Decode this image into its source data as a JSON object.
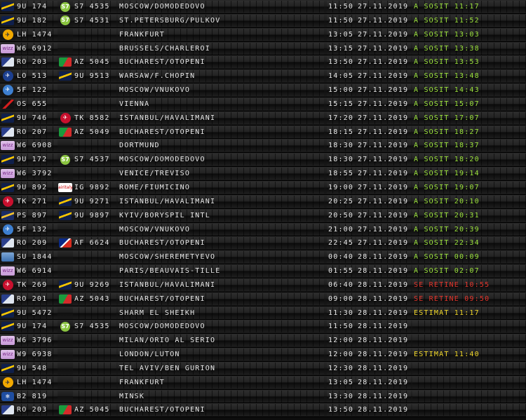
{
  "flights": [
    {
      "logo": "wizz-9u-icon",
      "logo_class": "lg-9u",
      "flight": "9U 174",
      "codeshare_logo": "s7-icon",
      "codeshare_class": "lg-s7",
      "codeshare": "S7 4535",
      "destination": "MOSCOW/DOMODEDOVO",
      "time": "11:50",
      "date": "27.11.2019",
      "status": "A SOSIT 11:17",
      "status_color": "green"
    },
    {
      "logo": "air-moldova-icon",
      "logo_class": "lg-9u",
      "flight": "9U 182",
      "codeshare_logo": "s7-icon",
      "codeshare_class": "lg-s7",
      "codeshare": "S7 4531",
      "destination": "ST.PETERSBURG/PULKOV",
      "time": "11:50",
      "date": "27.11.2019",
      "status": "A SOSIT 11:52",
      "status_color": "green"
    },
    {
      "logo": "lufthansa-icon",
      "logo_class": "lg-lh",
      "flight": "LH 1474",
      "codeshare_logo": "",
      "codeshare_class": "",
      "codeshare": "",
      "destination": "FRANKFURT",
      "time": "13:05",
      "date": "27.11.2019",
      "status": "A SOSIT 13:03",
      "status_color": "green"
    },
    {
      "logo": "wizz-air-icon",
      "logo_class": "lg-w6",
      "flight": "W6 6912",
      "codeshare_logo": "",
      "codeshare_class": "",
      "codeshare": "",
      "destination": "BRUSSELS/CHARLEROI",
      "time": "13:15",
      "date": "27.11.2019",
      "status": "A SOSIT 13:38",
      "status_color": "green"
    },
    {
      "logo": "tarom-icon",
      "logo_class": "lg-ro",
      "flight": "RO 203",
      "codeshare_logo": "alitalia-icon",
      "codeshare_class": "lg-az",
      "codeshare": "AZ 5045",
      "destination": "BUCHAREST/OTOPENI",
      "time": "13:50",
      "date": "27.11.2019",
      "status": "A SOSIT 13:53",
      "status_color": "green"
    },
    {
      "logo": "lot-icon",
      "logo_class": "lg-lo",
      "flight": "LO 513",
      "codeshare_logo": "air-moldova-icon",
      "codeshare_class": "lg-9u",
      "codeshare": "9U 9513",
      "destination": "WARSAW/F.CHOPIN",
      "time": "14:05",
      "date": "27.11.2019",
      "status": "A SOSIT 13:48",
      "status_color": "green"
    },
    {
      "logo": "utair-icon",
      "logo_class": "lg-5f",
      "flight": "5F 122",
      "codeshare_logo": "",
      "codeshare_class": "",
      "codeshare": "",
      "destination": "MOSCOW/VNUKOVO",
      "time": "15:00",
      "date": "27.11.2019",
      "status": "A SOSIT 14:43",
      "status_color": "green"
    },
    {
      "logo": "austrian-icon",
      "logo_class": "lg-os",
      "flight": "OS 655",
      "codeshare_logo": "",
      "codeshare_class": "",
      "codeshare": "",
      "destination": "VIENNA",
      "time": "15:15",
      "date": "27.11.2019",
      "status": "A SOSIT 15:07",
      "status_color": "green"
    },
    {
      "logo": "air-moldova-icon",
      "logo_class": "lg-9u",
      "flight": "9U 746",
      "codeshare_logo": "turkish-airlines-icon",
      "codeshare_class": "lg-tk",
      "codeshare": "TK 8582",
      "destination": "ISTANBUL/HAVALIMANI",
      "time": "17:20",
      "date": "27.11.2019",
      "status": "A SOSIT 17:07",
      "status_color": "green"
    },
    {
      "logo": "tarom-icon",
      "logo_class": "lg-ro",
      "flight": "RO 207",
      "codeshare_logo": "alitalia-icon",
      "codeshare_class": "lg-az",
      "codeshare": "AZ 5049",
      "destination": "BUCHAREST/OTOPENI",
      "time": "18:15",
      "date": "27.11.2019",
      "status": "A SOSIT 18:27",
      "status_color": "green"
    },
    {
      "logo": "wizz-air-icon",
      "logo_class": "lg-w6",
      "flight": "W6 6908",
      "codeshare_logo": "",
      "codeshare_class": "",
      "codeshare": "",
      "destination": "DORTMUND",
      "time": "18:30",
      "date": "27.11.2019",
      "status": "A SOSIT 18:37",
      "status_color": "green"
    },
    {
      "logo": "air-moldova-icon",
      "logo_class": "lg-9u",
      "flight": "9U 172",
      "codeshare_logo": "s7-icon",
      "codeshare_class": "lg-s7",
      "codeshare": "S7 4537",
      "destination": "MOSCOW/DOMODEDOVO",
      "time": "18:30",
      "date": "27.11.2019",
      "status": "A SOSIT 18:20",
      "status_color": "green"
    },
    {
      "logo": "wizz-air-icon",
      "logo_class": "lg-w6",
      "flight": "W6 3792",
      "codeshare_logo": "",
      "codeshare_class": "",
      "codeshare": "",
      "destination": "VENICE/TREVISO",
      "time": "18:55",
      "date": "27.11.2019",
      "status": "A SOSIT 19:14",
      "status_color": "green"
    },
    {
      "logo": "air-moldova-icon",
      "logo_class": "lg-9u",
      "flight": "9U 892",
      "codeshare_logo": "airitaly-icon",
      "codeshare_class": "lg-ig",
      "codeshare": "IG 9892",
      "destination": "ROME/FIUMICINO",
      "time": "19:00",
      "date": "27.11.2019",
      "status": "A SOSIT 19:07",
      "status_color": "green"
    },
    {
      "logo": "turkish-airlines-icon",
      "logo_class": "lg-tk",
      "flight": "TK 271",
      "codeshare_logo": "air-moldova-icon",
      "codeshare_class": "lg-9u",
      "codeshare": "9U 9271",
      "destination": "ISTANBUL/HAVALIMANI",
      "time": "20:25",
      "date": "27.11.2019",
      "status": "A SOSIT 20:10",
      "status_color": "green"
    },
    {
      "logo": "ukraine-intl-icon",
      "logo_class": "lg-ps",
      "flight": "PS 897",
      "codeshare_logo": "air-moldova-icon",
      "codeshare_class": "lg-9u",
      "codeshare": "9U 9897",
      "destination": "KYIV/BORYSPIL INTL",
      "time": "20:50",
      "date": "27.11.2019",
      "status": "A SOSIT 20:31",
      "status_color": "green"
    },
    {
      "logo": "utair-icon",
      "logo_class": "lg-5f",
      "flight": "5F 132",
      "codeshare_logo": "",
      "codeshare_class": "",
      "codeshare": "",
      "destination": "MOSCOW/VNUKOVO",
      "time": "21:00",
      "date": "27.11.2019",
      "status": "A SOSIT 20:39",
      "status_color": "green"
    },
    {
      "logo": "tarom-icon",
      "logo_class": "lg-ro",
      "flight": "RO 209",
      "codeshare_logo": "air-france-icon",
      "codeshare_class": "lg-af",
      "codeshare": "AF 6624",
      "destination": "BUCHAREST/OTOPENI",
      "time": "22:45",
      "date": "27.11.2019",
      "status": "A SOSIT 22:34",
      "status_color": "green"
    },
    {
      "logo": "aeroflot-icon",
      "logo_class": "lg-su",
      "flight": "SU 1844",
      "codeshare_logo": "",
      "codeshare_class": "",
      "codeshare": "",
      "destination": "MOSCOW/SHEREMETYEVO",
      "time": "00:40",
      "date": "28.11.2019",
      "status": "A SOSIT 00:09",
      "status_color": "green"
    },
    {
      "logo": "wizz-air-icon",
      "logo_class": "lg-w6",
      "flight": "W6 6914",
      "codeshare_logo": "",
      "codeshare_class": "",
      "codeshare": "",
      "destination": "PARIS/BEAUVAIS-TILLE",
      "time": "01:55",
      "date": "28.11.2019",
      "status": "A SOSIT 02:07",
      "status_color": "green"
    },
    {
      "logo": "turkish-airlines-icon",
      "logo_class": "lg-tk",
      "flight": "TK 269",
      "codeshare_logo": "air-moldova-icon",
      "codeshare_class": "lg-9u",
      "codeshare": "9U 9269",
      "destination": "ISTANBUL/HAVALIMANI",
      "time": "06:40",
      "date": "28.11.2019",
      "status": "SE RETINE 10:55",
      "status_color": "red"
    },
    {
      "logo": "tarom-icon",
      "logo_class": "lg-ro",
      "flight": "RO 201",
      "codeshare_logo": "alitalia-icon",
      "codeshare_class": "lg-az",
      "codeshare": "AZ 5043",
      "destination": "BUCHAREST/OTOPENI",
      "time": "09:00",
      "date": "28.11.2019",
      "status": "SE RETINE 09:50",
      "status_color": "red"
    },
    {
      "logo": "air-moldova-icon",
      "logo_class": "lg-9u",
      "flight": "9U 5472",
      "codeshare_logo": "",
      "codeshare_class": "",
      "codeshare": "",
      "destination": "SHARM EL SHEIKH",
      "time": "11:30",
      "date": "28.11.2019",
      "status": "ESTIMAT 11:17",
      "status_color": "yellow"
    },
    {
      "logo": "air-moldova-icon",
      "logo_class": "lg-9u",
      "flight": "9U 174",
      "codeshare_logo": "s7-icon",
      "codeshare_class": "lg-s7",
      "codeshare": "S7 4535",
      "destination": "MOSCOW/DOMODEDOVO",
      "time": "11:50",
      "date": "28.11.2019",
      "status": "",
      "status_color": "green"
    },
    {
      "logo": "wizz-air-icon",
      "logo_class": "lg-w6",
      "flight": "W6 3796",
      "codeshare_logo": "",
      "codeshare_class": "",
      "codeshare": "",
      "destination": "MILAN/ORIO AL SERIO",
      "time": "12:00",
      "date": "28.11.2019",
      "status": "",
      "status_color": "green"
    },
    {
      "logo": "wizz-air-uk-icon",
      "logo_class": "lg-w9",
      "flight": "W9 6938",
      "codeshare_logo": "",
      "codeshare_class": "",
      "codeshare": "",
      "destination": "LONDON/LUTON",
      "time": "12:00",
      "date": "28.11.2019",
      "status": "ESTIMAT 11:40",
      "status_color": "yellow"
    },
    {
      "logo": "air-moldova-icon",
      "logo_class": "lg-9u",
      "flight": "9U 548",
      "codeshare_logo": "",
      "codeshare_class": "",
      "codeshare": "",
      "destination": "TEL AVIV/BEN GURION",
      "time": "12:30",
      "date": "28.11.2019",
      "status": "",
      "status_color": "green"
    },
    {
      "logo": "lufthansa-icon",
      "logo_class": "lg-lh",
      "flight": "LH 1474",
      "codeshare_logo": "",
      "codeshare_class": "",
      "codeshare": "",
      "destination": "FRANKFURT",
      "time": "13:05",
      "date": "28.11.2019",
      "status": "",
      "status_color": "green"
    },
    {
      "logo": "belavia-icon",
      "logo_class": "lg-b2",
      "flight": "B2 819",
      "codeshare_logo": "",
      "codeshare_class": "",
      "codeshare": "",
      "destination": "MINSK",
      "time": "13:30",
      "date": "28.11.2019",
      "status": "",
      "status_color": "green"
    },
    {
      "logo": "tarom-icon",
      "logo_class": "lg-ro",
      "flight": "RO 203",
      "codeshare_logo": "alitalia-icon",
      "codeshare_class": "lg-az",
      "codeshare": "AZ 5045",
      "destination": "BUCHAREST/OTOPENI",
      "time": "13:50",
      "date": "28.11.2019",
      "status": "",
      "status_color": "green"
    }
  ],
  "logo_glyphs": {
    "lg-s7": "S7",
    "lg-lh": "✈",
    "lg-w6": "wizz",
    "lg-w9": "wizz",
    "lg-ig": "airitaly",
    "lg-tk": "✈",
    "lg-b2": "❄",
    "lg-5f": "✈",
    "lg-lo": "✈"
  }
}
